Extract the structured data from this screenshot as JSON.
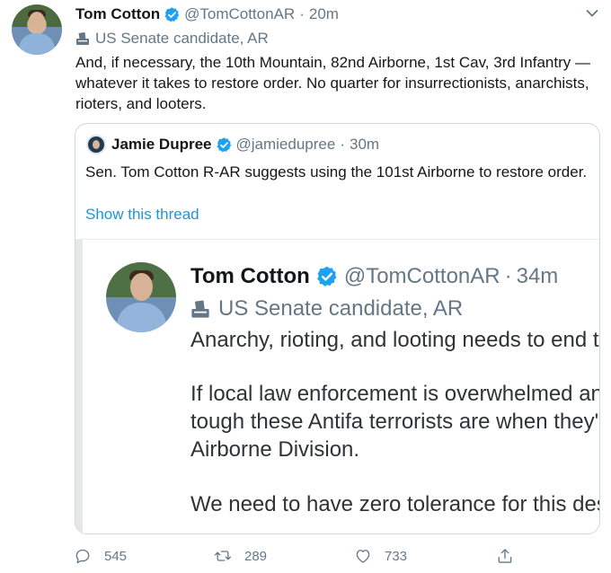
{
  "tweet": {
    "author_name": "Tom Cotton",
    "handle": "@TomCottonAR",
    "separator": "·",
    "time": "20m",
    "label": "US Senate candidate, AR",
    "text": "And, if necessary, the 10th Mountain, 82nd Airborne, 1st Cav, 3rd Infantry —whatever it takes to restore order. No quarter for insurrectionists, anarchists, rioters, and looters."
  },
  "quote": {
    "author_name": "Jamie Dupree",
    "handle": "@jamiedupree",
    "separator": "·",
    "time": "30m",
    "text": "Sen. Tom Cotton R-AR suggests using the 101st Airborne to restore order.",
    "show_thread": "Show this thread"
  },
  "embedded_screenshot": {
    "author_name": "Tom Cotton",
    "handle": "@TomCottonAR",
    "separator": "·",
    "time": "34m",
    "label": "US Senate candidate, AR",
    "lines": [
      "Anarchy, rioting, and looting needs to end t",
      "If local law enforcement is overwhelmed an",
      "tough these Antifa terrorists are when they'",
      "Airborne Division.",
      "We need to have zero tolerance for this des"
    ]
  },
  "actions": {
    "reply_count": "545",
    "retweet_count": "289",
    "like_count": "733"
  },
  "icons": {
    "verified": "verified-badge-icon",
    "label": "ballot-box-icon",
    "caret": "chevron-down-icon",
    "reply": "reply-icon",
    "retweet": "retweet-icon",
    "like": "heart-icon",
    "share": "share-icon"
  },
  "colors": {
    "verified_blue": "#1da1f2",
    "link_blue": "#1b95e0",
    "secondary_text": "#657786",
    "border": "#ccd6dd"
  }
}
